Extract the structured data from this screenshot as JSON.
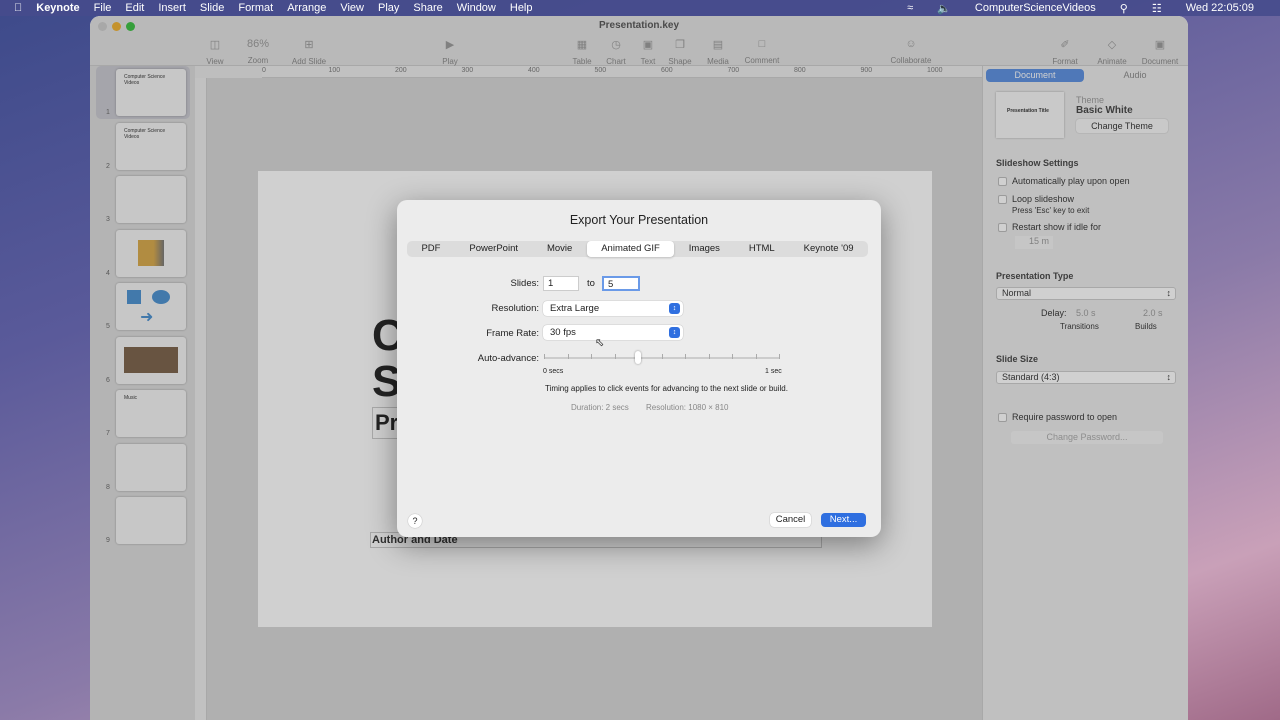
{
  "menubar": {
    "apple": "",
    "app": "Keynote",
    "items": [
      "File",
      "Edit",
      "Insert",
      "Slide",
      "Format",
      "Arrange",
      "View",
      "Play",
      "Share",
      "Window",
      "Help"
    ],
    "user": "ComputerScienceVideos",
    "clock": "Wed  22:05:09"
  },
  "window": {
    "title": "Presentation.key",
    "toolbar": {
      "view": "View",
      "zoom_value": "86%",
      "zoom": "Zoom",
      "add_slide": "Add Slide",
      "play": "Play",
      "table": "Table",
      "chart": "Chart",
      "text": "Text",
      "shape": "Shape",
      "media": "Media",
      "comment": "Comment",
      "collaborate": "Collaborate",
      "format": "Format",
      "animate": "Animate",
      "document": "Document"
    },
    "ruler": [
      "0",
      "100",
      "200",
      "300",
      "400",
      "500",
      "600",
      "700",
      "800",
      "900",
      "1000"
    ]
  },
  "slides": [
    {
      "num": "1",
      "text": "Computer Science Videos"
    },
    {
      "num": "2",
      "text": "Computer Science Videos"
    },
    {
      "num": "3",
      "text": ""
    },
    {
      "num": "4",
      "text": ""
    },
    {
      "num": "5",
      "text": ""
    },
    {
      "num": "6",
      "text": ""
    },
    {
      "num": "7",
      "text": "Music"
    },
    {
      "num": "8",
      "text": ""
    },
    {
      "num": "9",
      "text": ""
    }
  ],
  "slide_canvas": {
    "line1": "C",
    "line2": "S",
    "line3": "Pr",
    "author": "Author and Date"
  },
  "inspector": {
    "tab_document": "Document",
    "tab_audio": "Audio",
    "theme_label": "Theme",
    "theme_name": "Basic White",
    "theme_thumb": "Presentation Title",
    "change_theme": "Change Theme",
    "slideshow_settings": "Slideshow Settings",
    "auto_play": "Automatically play upon open",
    "loop": "Loop slideshow",
    "loop_hint": "Press 'Esc' key to exit",
    "restart": "Restart show if idle for",
    "idle_value": "15 m",
    "presentation_type": "Presentation Type",
    "type_value": "Normal",
    "delay": "Delay:",
    "transitions_value": "5.0 s",
    "builds_value": "2.0 s",
    "transitions": "Transitions",
    "builds": "Builds",
    "slide_size": "Slide Size",
    "size_value": "Standard (4:3)",
    "require_password": "Require password to open",
    "change_password": "Change Password..."
  },
  "dialog": {
    "title": "Export Your Presentation",
    "tabs": [
      "PDF",
      "PowerPoint",
      "Movie",
      "Animated GIF",
      "Images",
      "HTML",
      "Keynote '09"
    ],
    "active_tab": "Animated GIF",
    "slides_label": "Slides:",
    "from": "1",
    "to_label": "to",
    "to": "5",
    "resolution_label": "Resolution:",
    "resolution": "Extra Large",
    "frame_rate_label": "Frame Rate:",
    "frame_rate": "30 fps",
    "auto_advance_label": "Auto-advance:",
    "auto_advance_fraction": 0.4,
    "min_label": "0 secs",
    "max_label": "1 sec",
    "timing_note": "Timing applies to click events for advancing to the next slide or build.",
    "duration": "Duration: 2 secs",
    "resolution_info": "Resolution: 1080 × 810",
    "help": "?",
    "cancel": "Cancel",
    "next": "Next..."
  }
}
